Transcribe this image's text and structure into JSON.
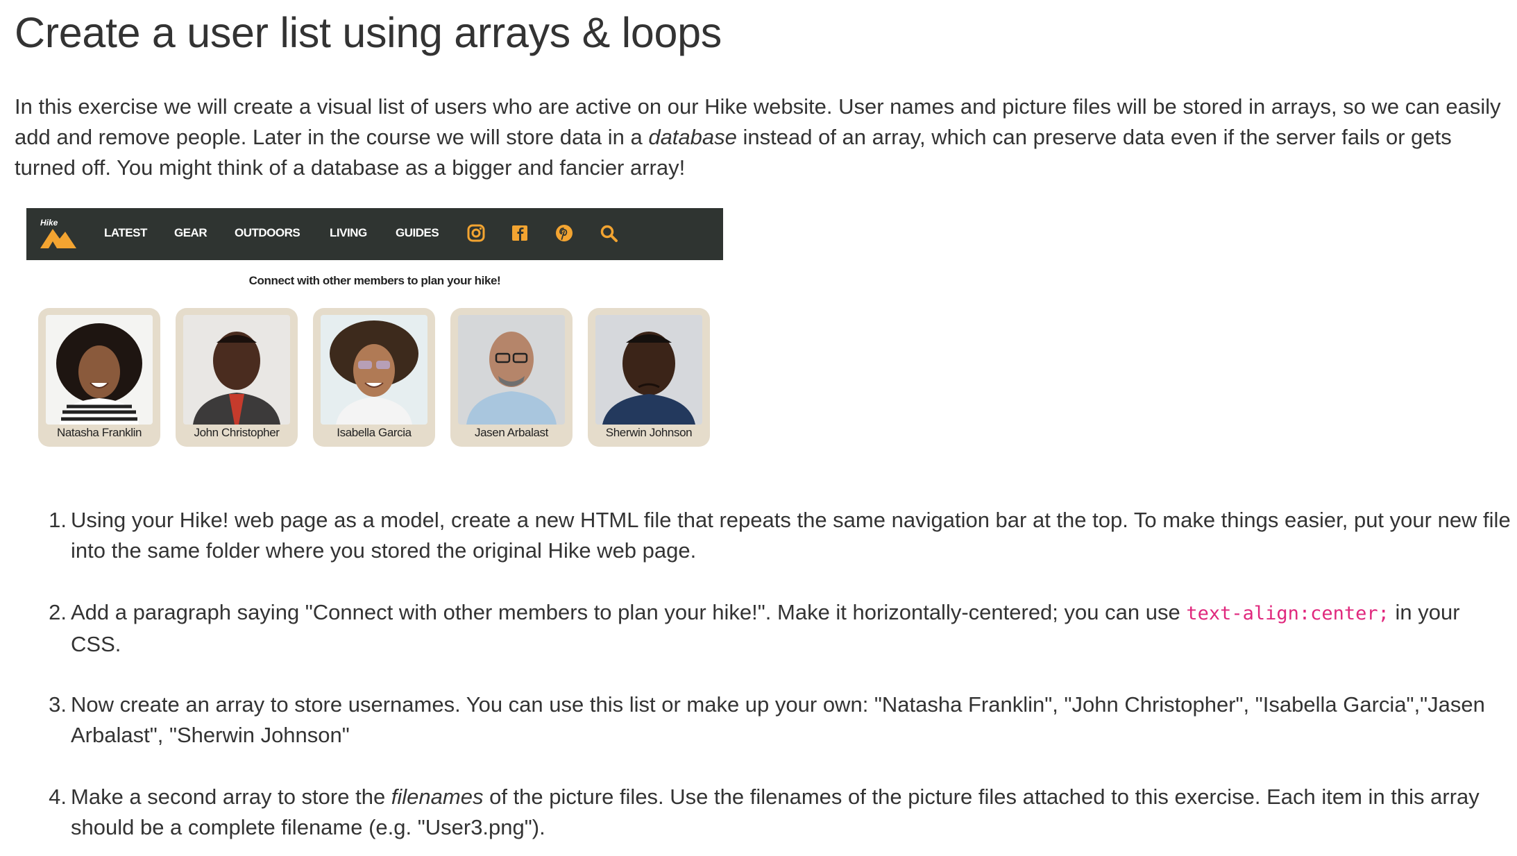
{
  "title": "Create a user list using arrays & loops",
  "intro": {
    "part1": "In this exercise we will create a visual list of users who are active on our Hike website.  User names and picture files will be stored in arrays, so we can easily add and remove people.  Later in the course we will store data in a ",
    "emphasis": "database",
    "part2": " instead of an array, which can preserve data even if the server fails or gets turned off.  You might think of a database as a bigger and fancier array!"
  },
  "hike_page": {
    "logo_text": "Hike",
    "nav_items": [
      "LATEST",
      "GEAR",
      "OUTDOORS",
      "LIVING",
      "GUIDES"
    ],
    "nav_icons": [
      "instagram-icon",
      "facebook-icon",
      "pinterest-icon",
      "search-icon"
    ],
    "accent_color": "#f3a431",
    "navbar_color": "#2f3431",
    "tagline": "Connect with other members to plan your hike!",
    "users": [
      {
        "name": "Natasha Franklin"
      },
      {
        "name": "John Christopher"
      },
      {
        "name": "Isabella Garcia"
      },
      {
        "name": "Jasen Arbalast"
      },
      {
        "name": "Sherwin Johnson"
      }
    ]
  },
  "steps": [
    {
      "number": "1.",
      "text": "Using your Hike! web page as a model, create a new HTML file that repeats the same navigation bar at the top.  To make things easier, put your new file into the same folder where you stored the original Hike web page."
    },
    {
      "number": "2.",
      "text_before": "Add a paragraph saying \"Connect with other members to plan your hike!\".  Make it horizontally-centered; you can use ",
      "code": "text-align:center;",
      "text_after": " in your CSS."
    },
    {
      "number": "3.",
      "text": "Now create an array to store usernames.  You can use this list or make up your own: \"Natasha Franklin\", \"John Christopher\", \"Isabella Garcia\",\"Jasen Arbalast\", \"Sherwin Johnson\""
    },
    {
      "number": "4.",
      "text_before": "Make a second array to store the ",
      "emphasis": "filenames",
      "text_after": " of the picture files.  Use the filenames of the picture files attached to this exercise.  Each item in this array should be a complete filename (e.g. \"User3.png\")."
    }
  ]
}
